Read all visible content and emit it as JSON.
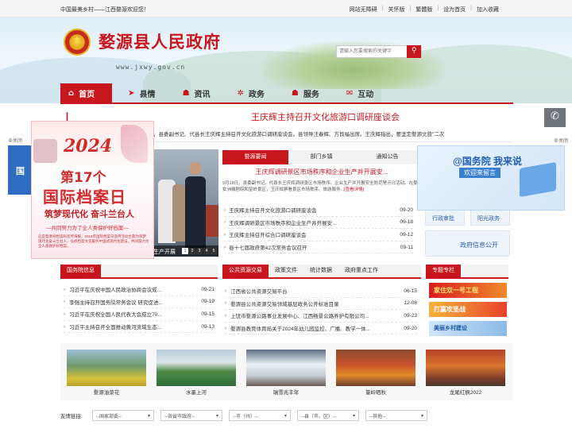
{
  "topbar": {
    "welcome": "中国最美乡村——江西婺源欢迎您！",
    "links": [
      "网站无障碍",
      "关怀版",
      "繁體版",
      "设为首页",
      "加入收藏"
    ]
  },
  "header": {
    "site_title": "婺源县人民政府",
    "site_url": "www.jxwy.gov.cn",
    "search_placeholder": "请输入您要搜索的关键字"
  },
  "nav": {
    "items": [
      {
        "label": "首页",
        "icon": "home-icon",
        "active": true
      },
      {
        "label": "县情",
        "icon": "flag-icon",
        "active": false
      },
      {
        "label": "资讯",
        "icon": "person-icon",
        "active": false
      },
      {
        "label": "政务",
        "icon": "gear-icon",
        "active": false
      },
      {
        "label": "服务",
        "icon": "person-icon",
        "active": false
      },
      {
        "label": "互动",
        "icon": "chat-icon",
        "active": false
      }
    ]
  },
  "headline": {
    "title": "王庆辉主持召开文化旅游口调研座谈会",
    "summary": "，县委副书记、代县长王庆辉主持召开文化旅游口调研座谈会。县领导汪春辉、方良福出席。王庆辉指出，要坚定婺源文旅\"二次"
  },
  "float_ads": {
    "close_label": "关闭",
    "archives_day": {
      "year": "2024",
      "line1": "第17个",
      "line2": "国际档案日",
      "slogan": "筑梦现代化  奋斗兰台人",
      "sub": "—共同努力为了全人类保护好档案—",
      "text": "这是婺源县档案局宣传海报，2024年国际档案日宣传活动主题为筑梦现代化奋斗兰台人，弘扬档案文化服务中国式现代化建设，共同努力为全人类保护好档案。"
    },
    "edge_text": "国",
    "gov_ad": {
      "title": "@国务院 我来说",
      "button": "欢迎来留言"
    },
    "wechat_icon": "wechat-icon"
  },
  "carousel": {
    "caption": "生产开展",
    "pages": [
      "1",
      "2",
      "3",
      "4",
      "5"
    ],
    "active_page": 1
  },
  "news_tabs": {
    "tabs": [
      "婺源要闻",
      "部门乡镇",
      "通知公告"
    ],
    "feature_title": "王庆辉调研景区市场秩序和企业生产井开展安...",
    "feature_desc": "9月18日，县委副书记、代县长王庆辉调研景区市场秩序、企业生产并开展安全防范警示日活动。在婺女洲徽剧院和篁岭景区，王庆辉察看景区市场秩序、旅游服务...",
    "more": "[查看详情]",
    "items": [
      {
        "title": "王庆辉主持召开文化旅游口调研座谈会",
        "date": "09-20"
      },
      {
        "title": "王庆辉调研景区市场秩序和企业生产井开展安...",
        "date": "09-18"
      },
      {
        "title": "王庆辉主持召开综合口调研座谈会",
        "date": "09-12"
      },
      {
        "title": "县十七届政府第42次常务会议召开",
        "date": "09-11"
      }
    ]
  },
  "services": {
    "items": [
      "行政审批",
      "阳光政务",
      "政府信息公开"
    ]
  },
  "state_council": {
    "tab": "国务院信息",
    "items": [
      {
        "title": "习近平在庆祝中国人民政治协商会议成...",
        "date": "09-21"
      },
      {
        "title": "李强主持召开国务院常务会议 研究促进...",
        "date": "09-19"
      },
      {
        "title": "习近平在庆祝全国人民代表大会成立70...",
        "date": "09-15"
      },
      {
        "title": "习近平主持召开全面推动黄河流域生态...",
        "date": "09-13"
      }
    ]
  },
  "public_resources": {
    "tabs": [
      "公共资源交易",
      "政策文件",
      "统计数据",
      "政府重点工作"
    ],
    "items": [
      {
        "title": "江西省公共资源交易平台",
        "date": "06-15"
      },
      {
        "title": "婺源县公共资源交易领域基层政务公开标准目录",
        "date": "12-08"
      },
      {
        "title": "上饶市婺源公路事业发展中心、江西畅景公路养护有限公司...",
        "date": "09-23"
      },
      {
        "title": "婺源县教育体育局关于2024年幼儿园监控、广播、教学一体...",
        "date": "09-20"
      }
    ]
  },
  "topics": {
    "tab": "专题专栏",
    "items": [
      "家住双一号工程",
      "打赢攻坚战",
      "美丽乡村建设"
    ]
  },
  "gallery": {
    "items": [
      {
        "label": "婺源油菜花"
      },
      {
        "label": "水墨上河"
      },
      {
        "label": "瑞雪兆丰年"
      },
      {
        "label": "篁岭晒秋"
      },
      {
        "label": "龙尾红枫2022"
      }
    ]
  },
  "friend_links": {
    "label": "友情链接:",
    "selects": [
      "--国家部委--",
      "--各省市政府--",
      "--市（州）--",
      "--县（市、区）--",
      "--其他--"
    ]
  },
  "colors": {
    "brand_red": "#c7161d",
    "gov_blue": "#2e6cc2"
  }
}
